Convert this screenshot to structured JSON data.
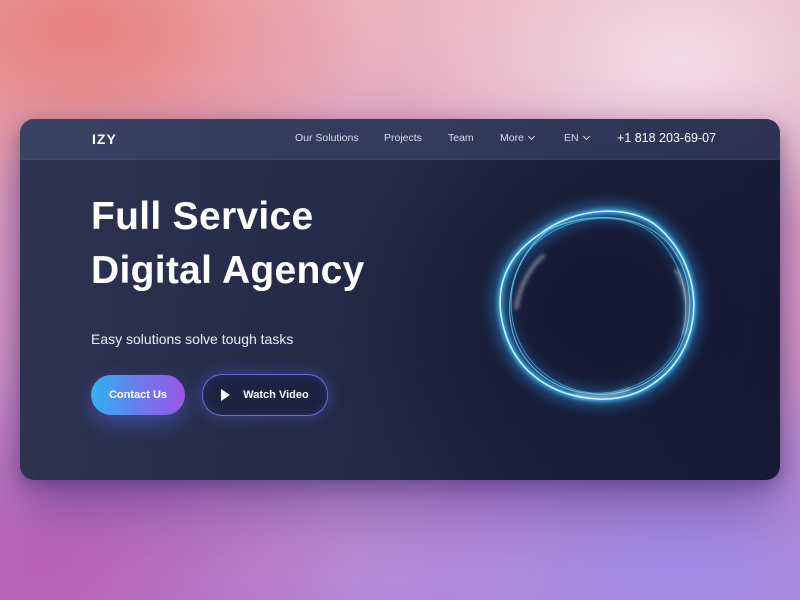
{
  "header": {
    "logo": "IZY",
    "nav": [
      {
        "label": "Our Solutions"
      },
      {
        "label": "Projects"
      },
      {
        "label": "Team"
      },
      {
        "label": "More"
      }
    ],
    "language": "EN",
    "phone": "+1 818 203-69-07"
  },
  "hero": {
    "title_line1": "Full Service",
    "title_line2": "Digital Agency",
    "subtitle": "Easy solutions solve tough tasks",
    "primary_button": "Contact Us",
    "secondary_button": "Watch Video"
  },
  "icons": {
    "more_dropdown": "chevron-down-icon",
    "language_dropdown": "chevron-down-icon",
    "video": "play-icon",
    "hero_graphic": "glowing-ring"
  },
  "colors": {
    "card_background": "#222a46",
    "button_gradient_start": "#2fb2f2",
    "button_gradient_end": "#9a57e6",
    "glow": "#4fd8ff"
  }
}
